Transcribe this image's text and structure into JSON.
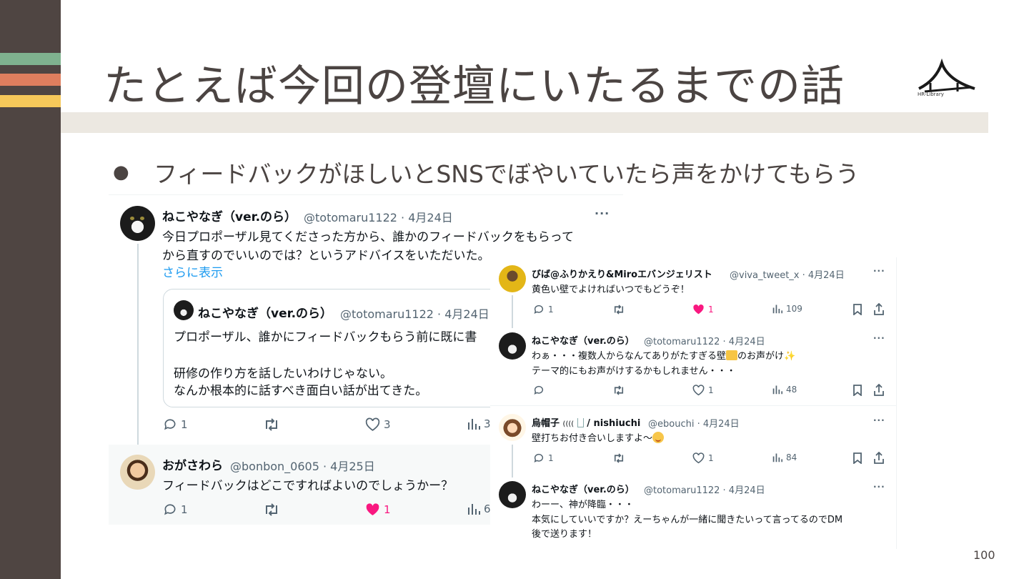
{
  "slide": {
    "title": "たとえば今回の登壇にいたるまでの話",
    "bullet": "フィードバックがほしいとSNSでぼやいていたら声をかけてもらう",
    "page_number": "100",
    "logo_text": "HR-Library",
    "stripe_colors": [
      "#7fb28f",
      "#df7e5e",
      "#f6c85a"
    ]
  },
  "tweet_main": {
    "name": "ねこやなぎ（ver.のら）",
    "handle": "@totomaru1122 · 4月24日",
    "text_line1": "今日プロポーザル見てくださった方から、誰かのフィードバックをもらって",
    "text_line2": "から直すのでいいのでは？というアドバイスをいただいた。",
    "show_more": "さらに表示",
    "more": "···",
    "quote": {
      "name": "ねこやなぎ（ver.のら）",
      "handle": "@totomaru1122 · 4月24日",
      "line1": "プロポーザル、誰かにフィードバックもらう前に既に書",
      "line2": "研修の作り方を話したいわけじゃない。",
      "line3": "なんか根本的に話すべき面白い話が出てきた。"
    },
    "replies": "1",
    "likes": "3",
    "views": "3"
  },
  "tweet_reply": {
    "name": "おがさわら",
    "handle": "@bonbon_0605 · 4月25日",
    "text": "フィードバックはどこですればよいのでしょうかー？",
    "replies": "1",
    "likes": "1",
    "views": "6"
  },
  "thread": [
    {
      "name": "びば@ふりかえり&Miroエバンジェリスト",
      "handle": "@viva_tweet_x · 4月24日",
      "text": "黄色い壁でよければいつでもどうぞ！",
      "replies": "1",
      "likes": "1",
      "views": "109",
      "liked": true
    },
    {
      "name": "ねこやなぎ（ver.のら）",
      "handle": "@totomaru1122 · 4月24日",
      "text_a": "わぁ・・・複数人からなんてありがたすぎる壁",
      "text_b": "のお声がけ",
      "text_line2": "テーマ的にもお声がけするかもしれません・・・",
      "replies": "",
      "likes": "1",
      "views": "48",
      "liked": false
    },
    {
      "name": "烏帽子",
      "name_extra": "((((",
      "name_tail": "/ nishiuchi",
      "handle": "@ebouchi · 4月24日",
      "text": "壁打ちお付き合いしますよ〜",
      "replies": "1",
      "likes": "1",
      "views": "84",
      "liked": false
    },
    {
      "name": "ねこやなぎ（ver.のら）",
      "handle": "@totomaru1122 · 4月24日",
      "line1": "わーー、神が降臨・・・",
      "line2": "本気にしていいですか？えーちゃんが一緒に聞きたいって言ってるのでDM",
      "line3": "後で送ります！"
    }
  ],
  "more_glyph": "···",
  "colors": {
    "accent_link": "#1d9bf0",
    "like_pink": "#f91880",
    "muted": "#536471",
    "slide_dark": "#4f4542"
  }
}
